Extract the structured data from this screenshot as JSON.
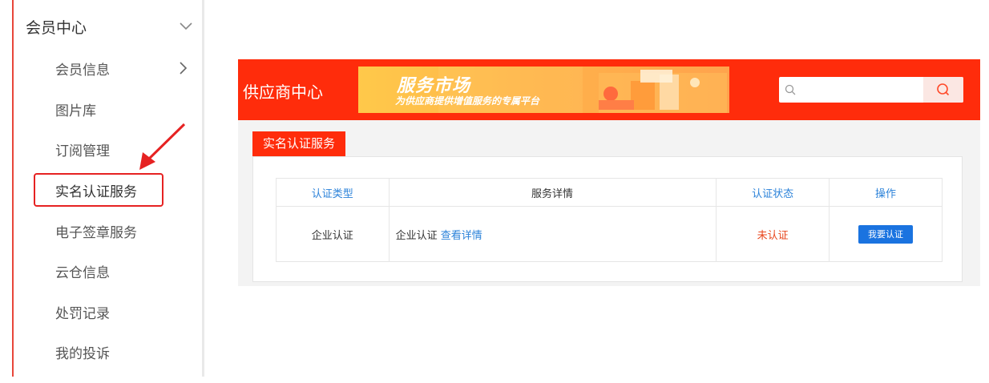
{
  "sidebar": {
    "header_label": "会员中心",
    "items": [
      {
        "label": "会员信息",
        "has_arrow": true
      },
      {
        "label": "图片库"
      },
      {
        "label": "订阅管理"
      },
      {
        "label": "实名认证服务",
        "highlighted": true
      },
      {
        "label": "电子签章服务"
      },
      {
        "label": "云仓信息"
      },
      {
        "label": "处罚记录"
      },
      {
        "label": "我的投诉"
      }
    ]
  },
  "supplier": {
    "title": "供应商中心",
    "banner": {
      "title": "服务市场",
      "subtitle": "为供应商提供增值服务的专属平台"
    },
    "search": {
      "placeholder": "",
      "value": ""
    },
    "tab_label": "实名认证服务",
    "table": {
      "headers": [
        "认证类型",
        "服务详情",
        "认证状态",
        "操作"
      ],
      "rows": [
        {
          "type": "企业认证",
          "detail_text": "企业认证",
          "detail_link": "查看详情",
          "status": "未认证",
          "action": "我要认证"
        }
      ]
    }
  },
  "colors": {
    "brand_red": "#ff2c0b",
    "link_blue": "#2b82d9",
    "button_blue": "#1a73e0",
    "status_red": "#e8461c",
    "annotation_red": "#e62222"
  }
}
